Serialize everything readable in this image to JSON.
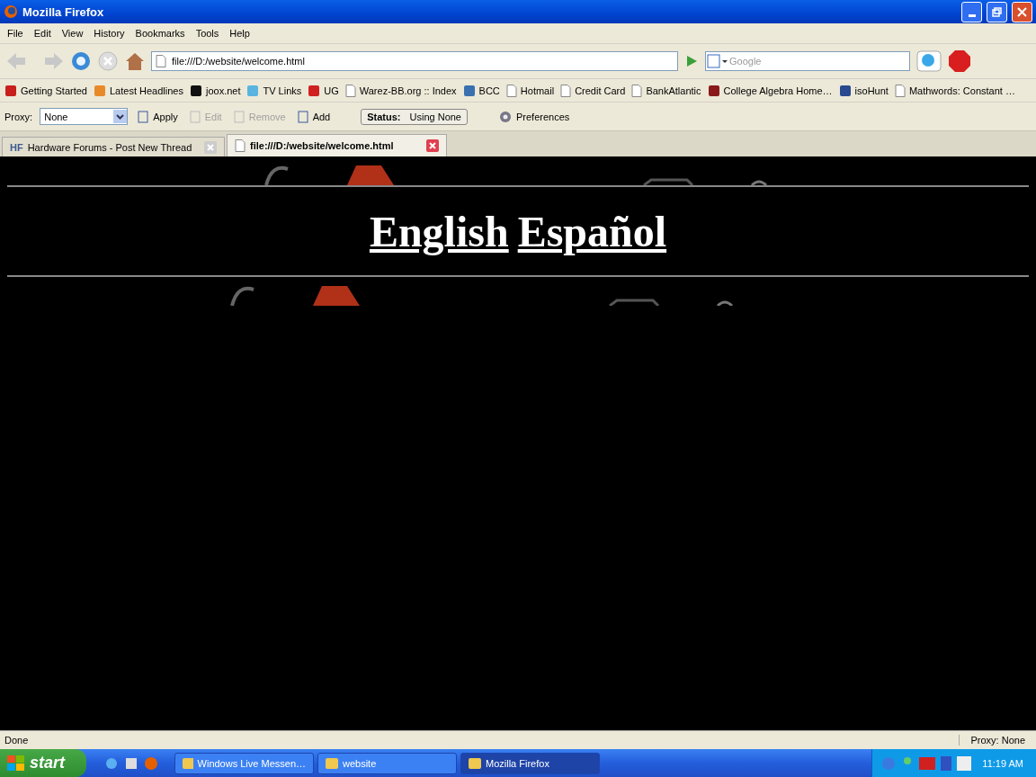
{
  "window": {
    "title": "Mozilla Firefox"
  },
  "menu": [
    "File",
    "Edit",
    "View",
    "History",
    "Bookmarks",
    "Tools",
    "Help"
  ],
  "nav": {
    "address": "file:///D:/website/welcome.html",
    "search_placeholder": "Google"
  },
  "bookmarks": [
    {
      "label": "Getting Started",
      "kind": "favicon",
      "color": "#c8201c"
    },
    {
      "label": "Latest Headlines",
      "kind": "favicon",
      "color": "#e8892a"
    },
    {
      "label": "joox.net",
      "kind": "favicon",
      "color": "#111111"
    },
    {
      "label": "TV Links",
      "kind": "favicon",
      "color": "#5ab4e0"
    },
    {
      "label": "UG",
      "kind": "favicon",
      "color": "#d02020"
    },
    {
      "label": "Warez-BB.org :: Index",
      "kind": "page"
    },
    {
      "label": "BCC",
      "kind": "favicon",
      "color": "#3a70b0"
    },
    {
      "label": "Hotmail",
      "kind": "page"
    },
    {
      "label": "Credit Card",
      "kind": "page"
    },
    {
      "label": "BankAtlantic",
      "kind": "page"
    },
    {
      "label": "College Algebra Home…",
      "kind": "favicon",
      "color": "#8a1a1a"
    },
    {
      "label": "isoHunt",
      "kind": "favicon",
      "color": "#2a4a90"
    },
    {
      "label": "Mathwords: Constant …",
      "kind": "page"
    }
  ],
  "proxy_bar": {
    "label": "Proxy:",
    "value": "None",
    "buttons": [
      {
        "label": "Apply",
        "disabled": false
      },
      {
        "label": "Edit",
        "disabled": true
      },
      {
        "label": "Remove",
        "disabled": true
      },
      {
        "label": "Add",
        "disabled": false
      }
    ],
    "status_label": "Status:",
    "status_value": "Using None",
    "preferences": "Preferences"
  },
  "tabs": [
    {
      "label": "Hardware Forums - Post New Thread",
      "badge": "HF",
      "selected": false
    },
    {
      "label": "file:///D:/website/welcome.html",
      "selected": true
    }
  ],
  "page": {
    "links": [
      "English",
      "Español"
    ]
  },
  "status_bar": {
    "text": "Done",
    "proxy": "Proxy: None"
  },
  "taskbar": {
    "start": "start",
    "tasks": [
      {
        "label": "Windows Live Messen…",
        "selected": false
      },
      {
        "label": "website",
        "selected": false
      },
      {
        "label": "Mozilla Firefox",
        "selected": true
      }
    ],
    "clock": "11:19 AM"
  }
}
